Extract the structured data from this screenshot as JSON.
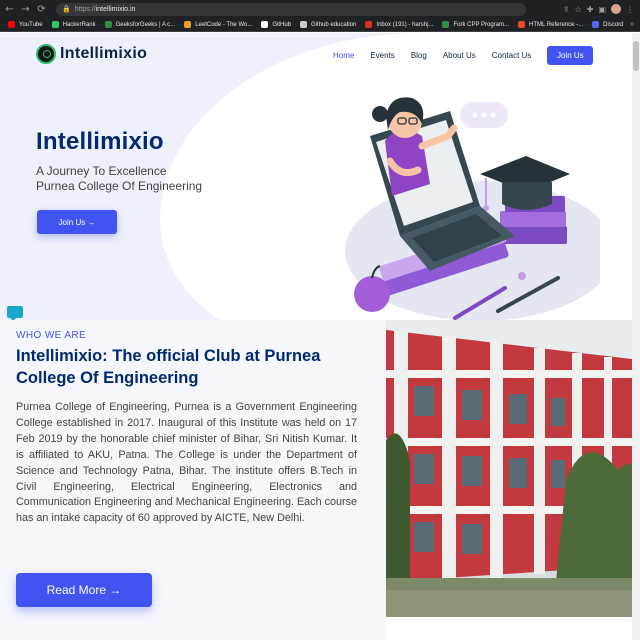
{
  "browser": {
    "url_scheme": "https://",
    "url_host": "intellimixio.in",
    "bookmarks": [
      {
        "label": "YouTube",
        "color": "#ff0000",
        "icon": "youtube-icon"
      },
      {
        "label": "HackerRank",
        "color": "#2ec866",
        "icon": "hackerrank-icon"
      },
      {
        "label": "GeeksforGeeks | A c...",
        "color": "#2f8d46",
        "icon": "gfg-icon"
      },
      {
        "label": "LeetCode - The Wo...",
        "color": "#f0a020",
        "icon": "leetcode-icon"
      },
      {
        "label": "GitHub",
        "color": "#ffffff",
        "icon": "github-icon"
      },
      {
        "label": "Github education",
        "color": "#cccccc",
        "icon": "github-edu-icon"
      },
      {
        "label": "Inbox (191) - harshj...",
        "color": "#d93025",
        "icon": "gmail-icon"
      },
      {
        "label": "Fork CPP Program...",
        "color": "#2f8d46",
        "icon": "gfg-icon"
      },
      {
        "label": "HTML Reference -...",
        "color": "#e34c26",
        "icon": "html-ref-icon"
      },
      {
        "label": "Discord",
        "color": "#5865f2",
        "icon": "discord-icon"
      }
    ],
    "more": "»"
  },
  "nav": {
    "logo_text": "Intellimixio",
    "items": [
      {
        "label": "Home",
        "active": true
      },
      {
        "label": "Events",
        "active": false
      },
      {
        "label": "Blog",
        "active": false
      },
      {
        "label": "About Us",
        "active": false
      },
      {
        "label": "Contact Us",
        "active": false
      }
    ],
    "join_label": "Join Us"
  },
  "hero": {
    "title": "Intellimixio",
    "subtitle_line1": "A Journey To Excellence",
    "subtitle_line2": "Purnea College Of Engineering",
    "cta_label": "Join Us →"
  },
  "about": {
    "label": "WHO WE ARE",
    "title": "Intellimixio: The official Club at Purnea College Of Engineering",
    "body": "Purnea College of Engineering, Purnea is a Government Engineering College established in 2017. Inaugural of this Institute was held on 17 Feb 2019 by the honorable chief minister of Bihar, Sri Nitish Kumar. It is affiliated to AKU, Patna. The College is under the Department of Science and Technology Patna, Bihar. The institute offers B.Tech in Civil Engineering, Electrical Engineering, Electronics and Communication Engineering and Mechanical Engineering. Each course has an intake capacity of 60 approved by AICTE, New Delhi.",
    "read_more_label": "Read More →"
  },
  "colors": {
    "accent": "#4154f1",
    "heading": "#012970",
    "browser_bg": "#202124"
  }
}
